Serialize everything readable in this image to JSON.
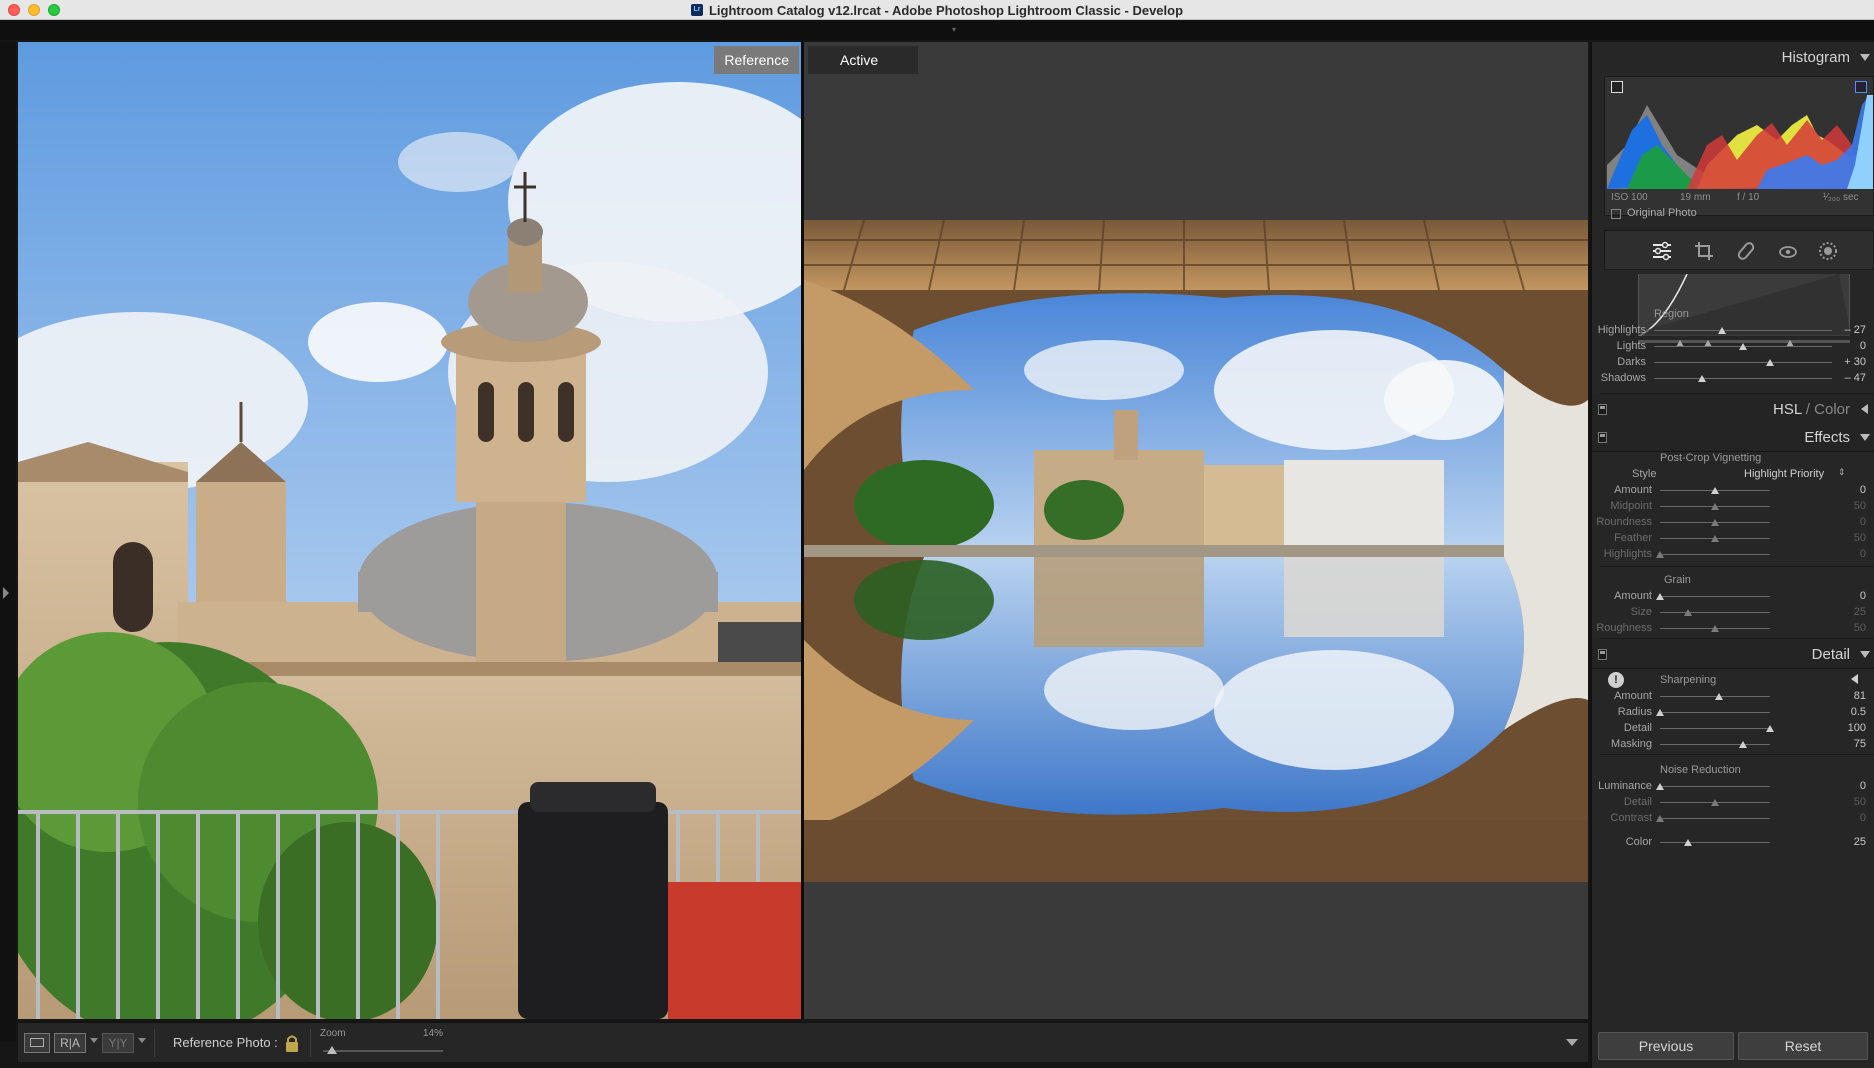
{
  "window": {
    "title": "Lightroom Catalog v12.lrcat - Adobe Photoshop Lightroom Classic - Develop",
    "icon_text": "Lr"
  },
  "compare": {
    "reference_tag": "Reference",
    "active_tag": "Active"
  },
  "toolbar": {
    "view_single_label": "",
    "view_ra_label": "R|A",
    "view_yy_label": "Y|Y",
    "reference_photo_label": "Reference Photo :",
    "zoom_label": "Zoom",
    "zoom_value": "14%"
  },
  "panels": {
    "histogram": {
      "title": "Histogram",
      "iso": "ISO 100",
      "focal": "19 mm",
      "aperture": "f / 10",
      "shutter": "¹⁄₂₀₀ sec",
      "original_photo_label": "Original Photo"
    },
    "tone_curve": {
      "region_title": "Region",
      "sliders": [
        {
          "label": "Highlights",
          "value": "– 27",
          "pos": 0.38,
          "dim": false
        },
        {
          "label": "Lights",
          "value": "0",
          "pos": 0.5,
          "dim": false
        },
        {
          "label": "Darks",
          "value": "+ 30",
          "pos": 0.65,
          "dim": false
        },
        {
          "label": "Shadows",
          "value": "– 47",
          "pos": 0.27,
          "dim": false
        }
      ]
    },
    "hsl": {
      "title_main": "HSL",
      "title_sep": " / ",
      "title_alt": "Color"
    },
    "effects": {
      "title": "Effects",
      "vignette_title": "Post-Crop Vignetting",
      "style_label": "Style",
      "style_value": "Highlight Priority",
      "vignette_sliders": [
        {
          "label": "Amount",
          "value": "0",
          "pos": 0.5,
          "dim": false
        },
        {
          "label": "Midpoint",
          "value": "50",
          "pos": 0.5,
          "dim": true
        },
        {
          "label": "Roundness",
          "value": "0",
          "pos": 0.5,
          "dim": true
        },
        {
          "label": "Feather",
          "value": "50",
          "pos": 0.5,
          "dim": true
        },
        {
          "label": "Highlights",
          "value": "0",
          "pos": 0.0,
          "dim": true
        }
      ],
      "grain_title": "Grain",
      "grain_sliders": [
        {
          "label": "Amount",
          "value": "0",
          "pos": 0.0,
          "dim": false
        },
        {
          "label": "Size",
          "value": "25",
          "pos": 0.25,
          "dim": true
        },
        {
          "label": "Roughness",
          "value": "50",
          "pos": 0.5,
          "dim": true
        }
      ]
    },
    "detail": {
      "title": "Detail",
      "sharpening_title": "Sharpening",
      "sharpening_sliders": [
        {
          "label": "Amount",
          "value": "81",
          "pos": 0.54,
          "dim": false
        },
        {
          "label": "Radius",
          "value": "0.5",
          "pos": 0.0,
          "dim": false
        },
        {
          "label": "Detail",
          "value": "100",
          "pos": 1.0,
          "dim": false
        },
        {
          "label": "Masking",
          "value": "75",
          "pos": 0.75,
          "dim": false
        }
      ],
      "noise_title": "Noise Reduction",
      "noise_sliders": [
        {
          "label": "Luminance",
          "value": "0",
          "pos": 0.0,
          "dim": false
        },
        {
          "label": "Detail",
          "value": "50",
          "pos": 0.5,
          "dim": true
        },
        {
          "label": "Contrast",
          "value": "0",
          "pos": 0.0,
          "dim": true
        },
        {
          "label": "Color",
          "value": "25",
          "pos": 0.25,
          "dim": false
        }
      ]
    }
  },
  "buttons": {
    "previous": "Previous",
    "reset": "Reset"
  }
}
